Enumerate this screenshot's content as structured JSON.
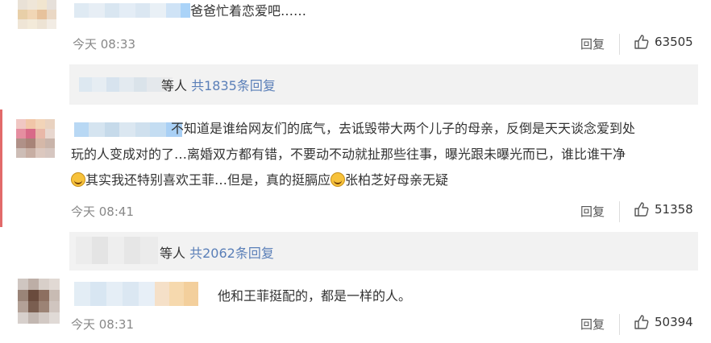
{
  "comments": [
    {
      "text": "爸爸忙着恋爱吧……",
      "time": "今天 08:33",
      "reply_label": "回复",
      "likes": "63505"
    },
    {
      "text_line1": "不知道是谁给网友们的底气，去诋毁带大两个儿子的母亲，反倒是天天谈念爱到处",
      "text_line2": "玩的人变成对的了…离婚双方都有错，不要动不动就扯那些往事，曝光跟未曝光而已，谁比谁干净",
      "text_line3a": "其实我还特别喜欢王菲…但是，真的挺膈应",
      "text_line3b": "张柏芝好母亲无疑",
      "time": "今天 08:41",
      "reply_label": "回复",
      "likes": "51358"
    },
    {
      "text": "他和王菲挺配的，都是一样的人。",
      "time": "今天 08:31",
      "reply_label": "回复",
      "likes": "50394"
    }
  ],
  "reply_threads": [
    {
      "suffix": "等人",
      "count_text": "共1835条回复"
    },
    {
      "suffix": "等人",
      "count_text": "共2062条回复"
    }
  ],
  "icons": {
    "like": "thumbs-up-icon",
    "emoji": "smile-emoji-icon"
  },
  "colors": {
    "link": "#5a7fb8",
    "muted": "#888888",
    "accent_bar": "#e26a6a",
    "reply_bg": "#f2f2f2"
  }
}
